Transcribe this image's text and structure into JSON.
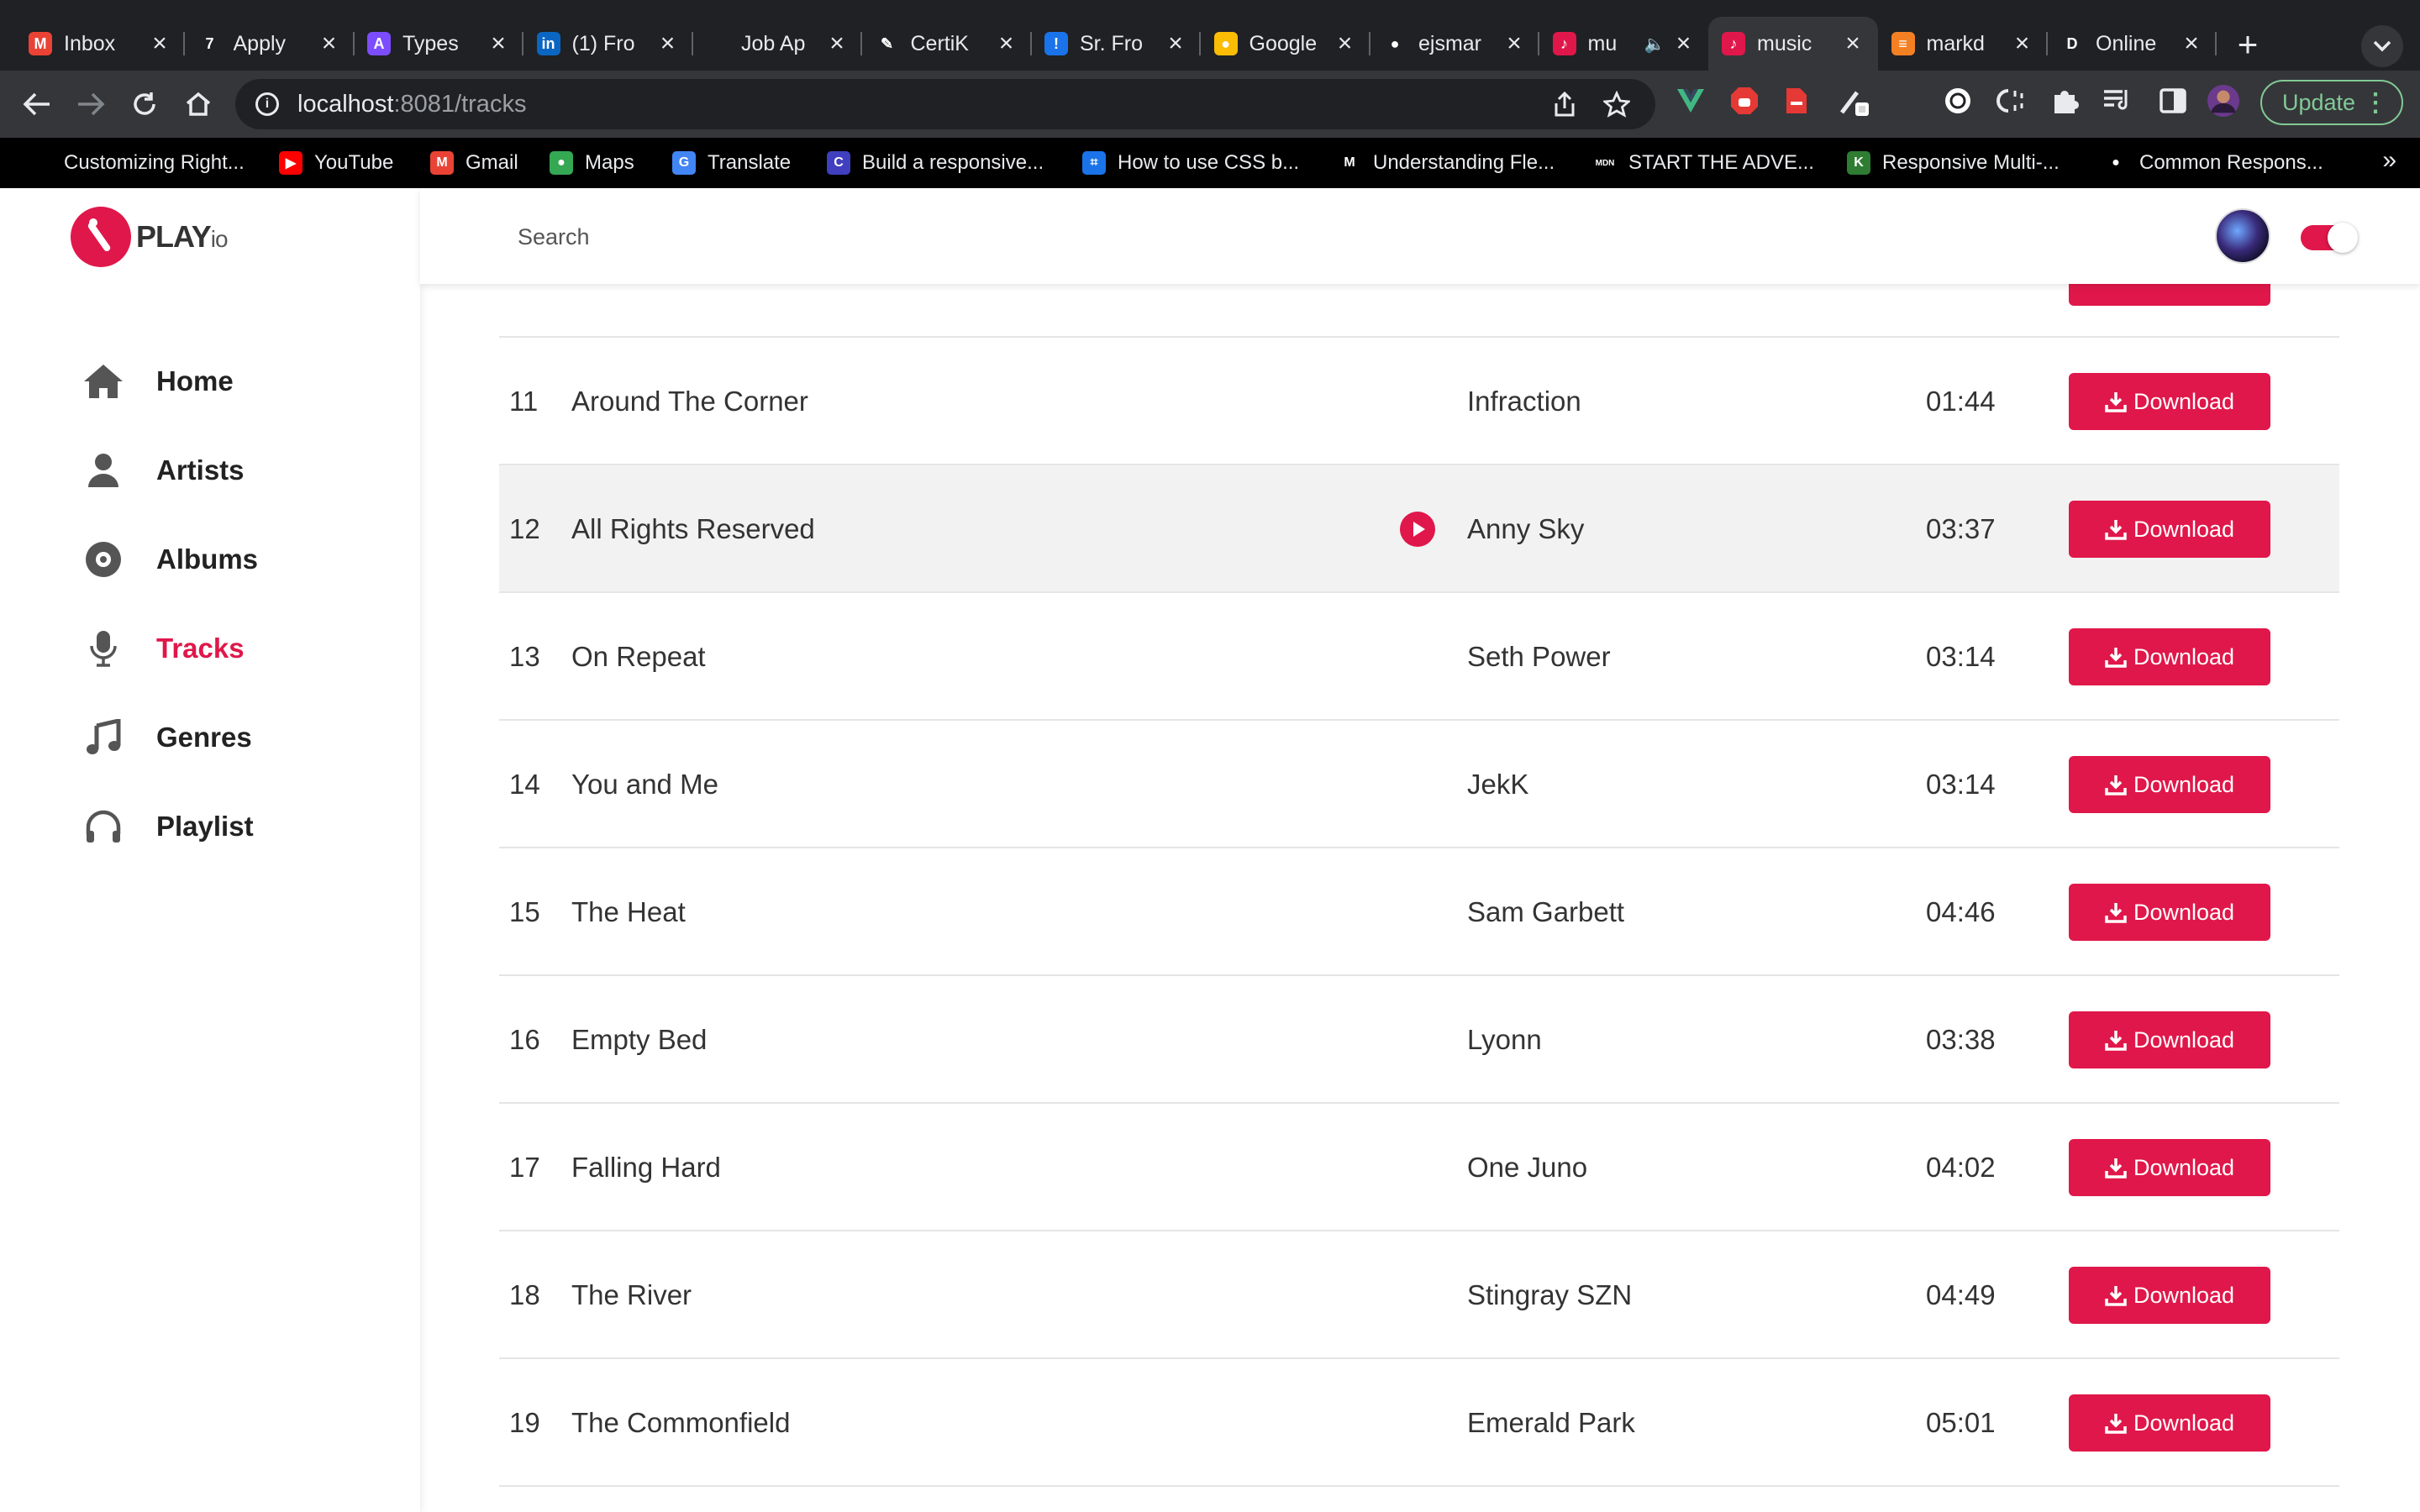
{
  "browser": {
    "tabs": [
      {
        "title": "Inbox",
        "favicon": "gmail-icon",
        "color": "#ea4335",
        "glyph": "M"
      },
      {
        "title": "Apply",
        "favicon": "apply-icon",
        "color": "#202124",
        "glyph": "7"
      },
      {
        "title": "Types",
        "favicon": "types-icon",
        "color": "#7c4dff",
        "glyph": "A"
      },
      {
        "title": "(1) Fro",
        "favicon": "linkedin-icon",
        "color": "#0a66c2",
        "glyph": "in"
      },
      {
        "title": "Job Ap",
        "favicon": "job-icon",
        "color": "#202124",
        "glyph": ""
      },
      {
        "title": "CertiK",
        "favicon": "certik-icon",
        "color": "#202124",
        "glyph": "✎"
      },
      {
        "title": "Sr. Fro",
        "favicon": "alert-icon",
        "color": "#1a73e8",
        "glyph": "!"
      },
      {
        "title": "Google",
        "favicon": "google-keep-icon",
        "color": "#fbbc04",
        "glyph": "●"
      },
      {
        "title": "ejsmar",
        "favicon": "github-icon",
        "color": "#202124",
        "glyph": "●"
      },
      {
        "title": "mu",
        "favicon": "music-app-icon",
        "color": "#e0174a",
        "glyph": "♪"
      },
      {
        "title": "music",
        "favicon": "music-app-icon",
        "color": "#e0174a",
        "glyph": "♪"
      },
      {
        "title": "markd",
        "favicon": "stackoverflow-icon",
        "color": "#f48024",
        "glyph": "≡"
      },
      {
        "title": "Online",
        "favicon": "d-icon",
        "color": "#202124",
        "glyph": "D"
      }
    ],
    "url_host": "localhost",
    "url_path": ":8081/tracks",
    "update_label": "Update",
    "bookmarks": [
      {
        "label": "Customizing Right...",
        "icon": ""
      },
      {
        "label": "YouTube",
        "icon": "youtube-icon",
        "color": "#ff0000",
        "glyph": "▶"
      },
      {
        "label": "Gmail",
        "icon": "gmail-icon",
        "color": "#ea4335",
        "glyph": "M"
      },
      {
        "label": "Maps",
        "icon": "maps-icon",
        "color": "#34a853",
        "glyph": "●"
      },
      {
        "label": "Translate",
        "icon": "translate-icon",
        "color": "#4285f4",
        "glyph": "G"
      },
      {
        "label": "Build a responsive...",
        "icon": "build-icon",
        "color": "#3f3fbf",
        "glyph": "C"
      },
      {
        "label": "How to use CSS b...",
        "icon": "css-icon",
        "color": "#1a73e8",
        "glyph": "⌗"
      },
      {
        "label": "Understanding Fle...",
        "icon": "medium-icon",
        "color": "#000000",
        "glyph": "M"
      },
      {
        "label": "START THE ADVE...",
        "icon": "mdn-icon",
        "color": "#000000",
        "glyph": "MDN"
      },
      {
        "label": "Responsive Multi-...",
        "icon": "multi-icon",
        "color": "#2e7d32",
        "glyph": "K"
      },
      {
        "label": "Common Respons...",
        "icon": "common-icon",
        "color": "#000000",
        "glyph": "●"
      }
    ]
  },
  "app": {
    "logo_text": "PLAY",
    "logo_suffix": "io",
    "brand_color": "#e0174a",
    "nav": [
      {
        "label": "Home",
        "icon": "home-icon"
      },
      {
        "label": "Artists",
        "icon": "user-icon"
      },
      {
        "label": "Albums",
        "icon": "disc-icon"
      },
      {
        "label": "Tracks",
        "icon": "microphone-icon",
        "active": true
      },
      {
        "label": "Genres",
        "icon": "music-note-icon"
      },
      {
        "label": "Playlist",
        "icon": "headphones-icon"
      }
    ],
    "search_placeholder": "Search",
    "theme_toggle_on": true
  },
  "tracks": {
    "download_label": "Download",
    "rows": [
      {
        "num": "11",
        "title": "Around The Corner",
        "artist": "Infraction",
        "duration": "01:44"
      },
      {
        "num": "12",
        "title": "All Rights Reserved",
        "artist": "Anny Sky",
        "duration": "03:37",
        "hover": true
      },
      {
        "num": "13",
        "title": "On Repeat",
        "artist": "Seth Power",
        "duration": "03:14"
      },
      {
        "num": "14",
        "title": "You and Me",
        "artist": "JekK",
        "duration": "03:14"
      },
      {
        "num": "15",
        "title": "The Heat",
        "artist": "Sam Garbett",
        "duration": "04:46"
      },
      {
        "num": "16",
        "title": "Empty Bed",
        "artist": "Lyonn",
        "duration": "03:38"
      },
      {
        "num": "17",
        "title": "Falling Hard",
        "artist": "One Juno",
        "duration": "04:02"
      },
      {
        "num": "18",
        "title": "The River",
        "artist": "Stingray SZN",
        "duration": "04:49"
      },
      {
        "num": "19",
        "title": "The Commonfield",
        "artist": "Emerald Park",
        "duration": "05:01"
      }
    ]
  }
}
